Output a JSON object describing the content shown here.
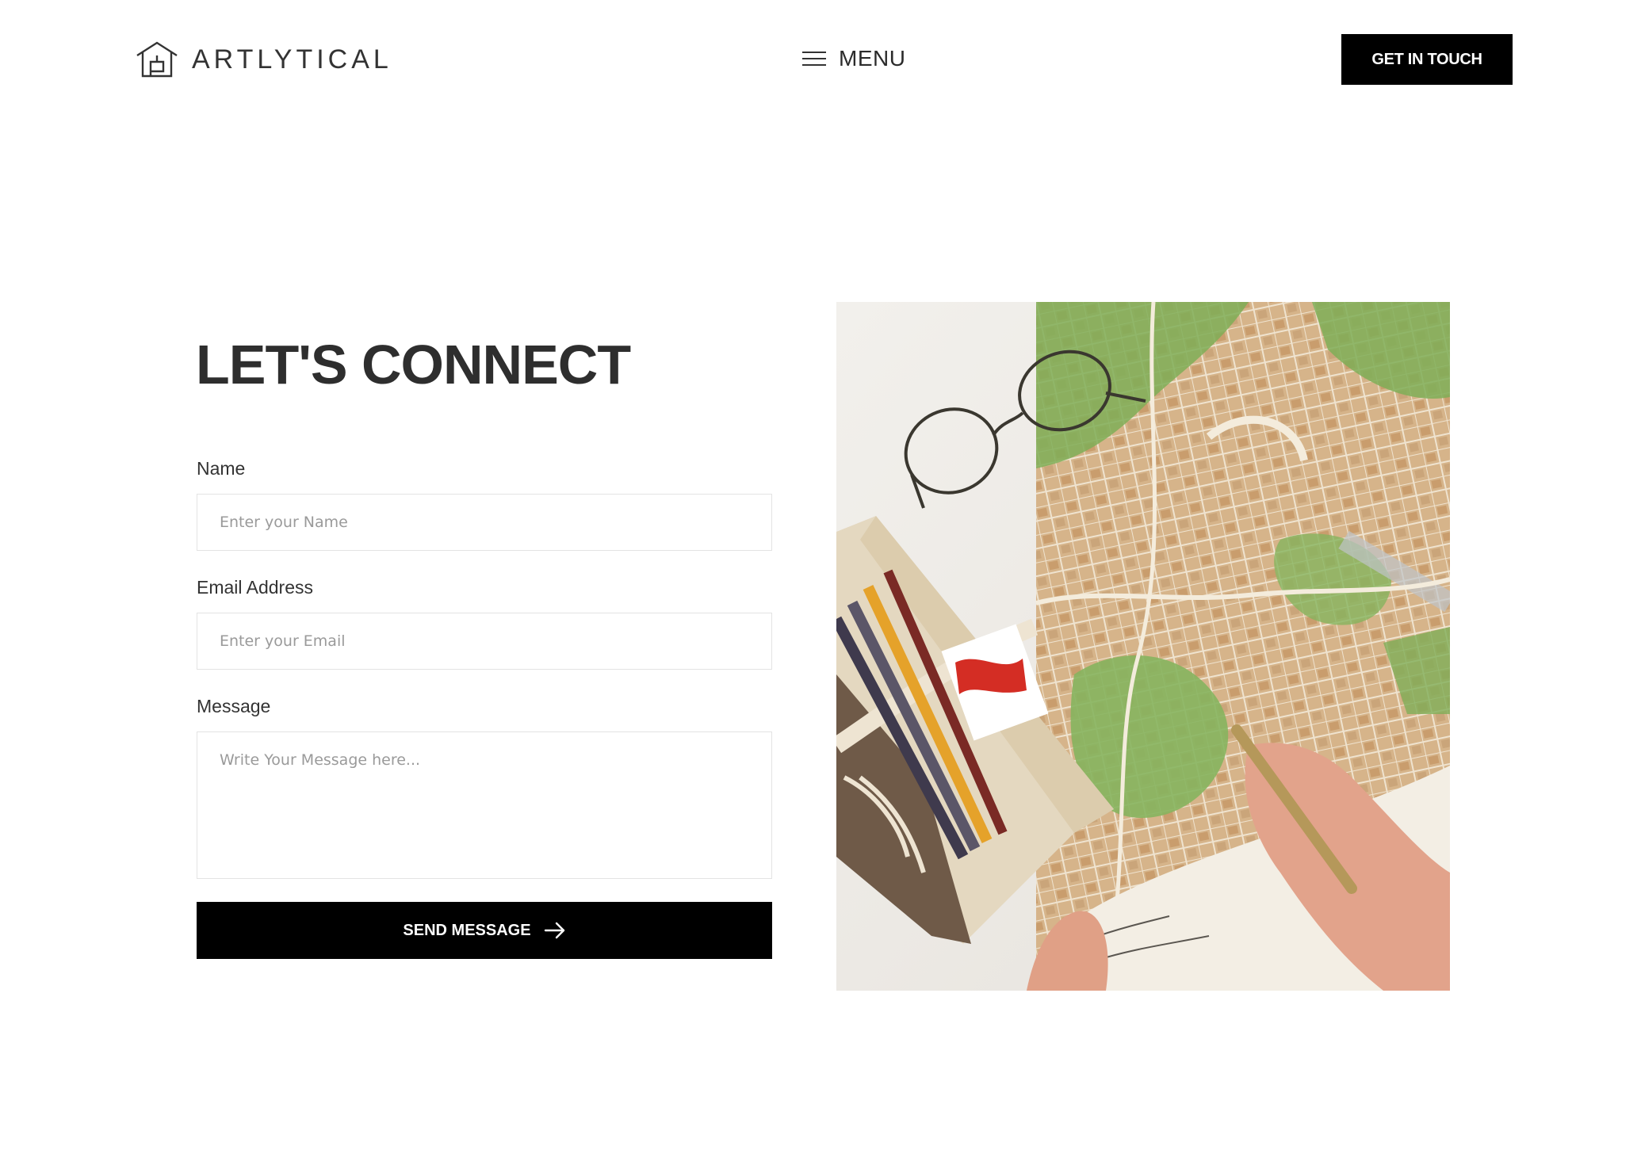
{
  "header": {
    "logo_text": "ARTLYTICAL",
    "menu_label": "MENU",
    "cta_label": "GET IN TOUCH"
  },
  "form": {
    "title": "LET'S CONNECT",
    "name_label": "Name",
    "name_placeholder": "Enter your Name",
    "email_label": "Email Address",
    "email_placeholder": "Enter your Email",
    "message_label": "Message",
    "message_placeholder": "Write Your Message here...",
    "submit_label": "SEND MESSAGE"
  },
  "photo": {
    "icons": [
      "eyeglasses-icon",
      "pencil-icon",
      "map-icon",
      "hand-icon",
      "pen-icon",
      "notebook-icon"
    ]
  },
  "colors": {
    "primary_button": "#000000",
    "heading_text": "#2e2e2e",
    "field_border": "#e3e3e3",
    "placeholder": "#9a9a9a"
  }
}
